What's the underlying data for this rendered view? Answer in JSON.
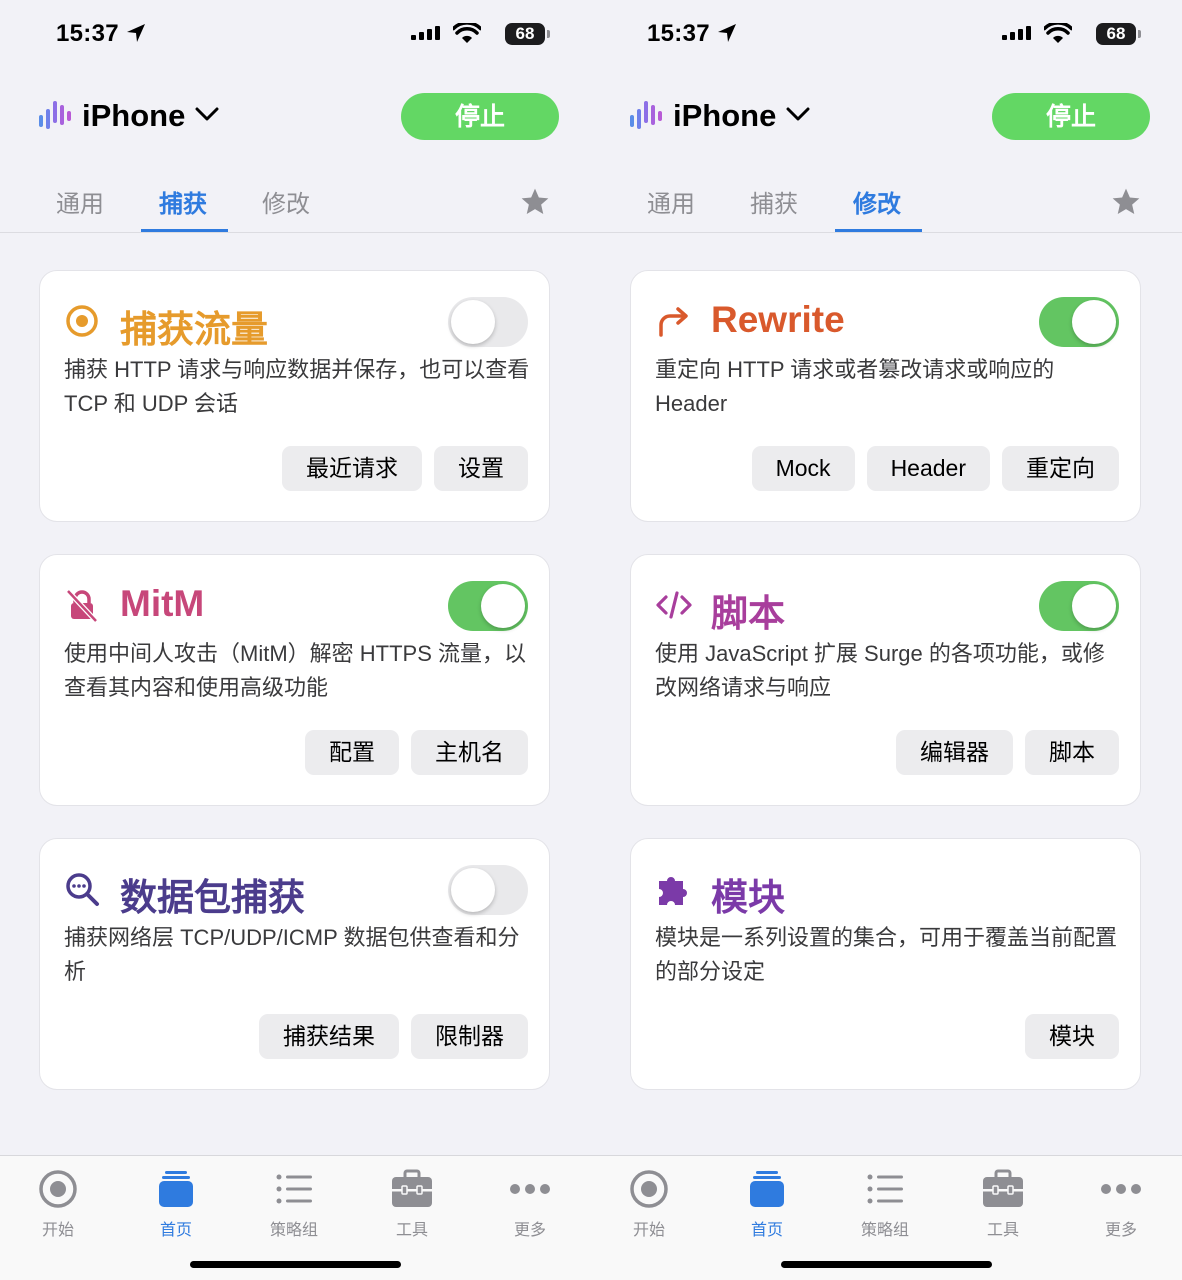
{
  "screens": [
    {
      "status": {
        "time": "15:37",
        "battery": "68"
      },
      "device": {
        "name": "iPhone"
      },
      "stop_label": "停止",
      "tabs": [
        {
          "label": "通用"
        },
        {
          "label": "捕获"
        },
        {
          "label": "修改"
        }
      ],
      "active_tab": 1,
      "cards": [
        {
          "title": "捕获流量",
          "color": "#e69b2c",
          "icon": "target-icon",
          "toggle": "off",
          "desc": "捕获 HTTP 请求与响应数据并保存，也可以查看 TCP 和 UDP 会话",
          "actions": [
            {
              "label": "最近请求"
            },
            {
              "label": "设置"
            }
          ]
        },
        {
          "title": "MitM",
          "color": "#c7477a",
          "icon": "lock-slash-icon",
          "toggle": "on",
          "desc": "使用中间人攻击（MitM）解密 HTTPS 流量，以查看其内容和使用高级功能",
          "actions": [
            {
              "label": "配置"
            },
            {
              "label": "主机名"
            }
          ]
        },
        {
          "title": "数据包捕获",
          "color": "#4b3c8c",
          "icon": "magnifier-icon",
          "toggle": "off",
          "desc": "捕获网络层 TCP/UDP/ICMP 数据包供查看和分析",
          "actions": [
            {
              "label": "捕获结果"
            },
            {
              "label": "限制器"
            }
          ]
        }
      ],
      "tabbar": [
        {
          "label": "开始"
        },
        {
          "label": "首页"
        },
        {
          "label": "策略组"
        },
        {
          "label": "工具"
        },
        {
          "label": "更多"
        }
      ]
    },
    {
      "status": {
        "time": "15:37",
        "battery": "68"
      },
      "device": {
        "name": "iPhone"
      },
      "stop_label": "停止",
      "tabs": [
        {
          "label": "通用"
        },
        {
          "label": "捕获"
        },
        {
          "label": "修改"
        }
      ],
      "active_tab": 2,
      "cards": [
        {
          "title": "Rewrite",
          "color": "#d9592c",
          "icon": "redirect-arrow-icon",
          "toggle": "on",
          "desc": "重定向 HTTP 请求或者篡改请求或响应的 Header",
          "actions": [
            {
              "label": "Mock"
            },
            {
              "label": "Header"
            },
            {
              "label": "重定向"
            }
          ]
        },
        {
          "title": "脚本",
          "color": "#a83e9c",
          "icon": "code-icon",
          "toggle": "on",
          "desc": "使用 JavaScript 扩展 Surge 的各项功能，或修改网络请求与响应",
          "actions": [
            {
              "label": "编辑器"
            },
            {
              "label": "脚本"
            }
          ]
        },
        {
          "title": "模块",
          "color": "#7b3aa8",
          "icon": "puzzle-icon",
          "toggle": "none",
          "desc": "模块是一系列设置的集合，可用于覆盖当前配置的部分设定",
          "actions": [
            {
              "label": "模块"
            }
          ]
        }
      ],
      "tabbar": [
        {
          "label": "开始"
        },
        {
          "label": "首页"
        },
        {
          "label": "策略组"
        },
        {
          "label": "工具"
        },
        {
          "label": "更多"
        }
      ]
    }
  ],
  "colors": {
    "accent": "#2f7bdf",
    "toggle_on": "#63c562",
    "stop": "#63d764"
  }
}
